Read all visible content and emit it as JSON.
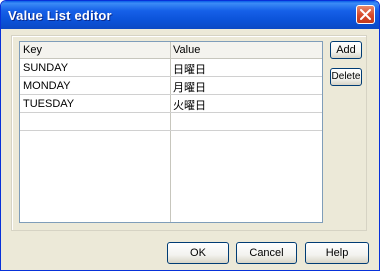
{
  "window": {
    "title": "Value List editor"
  },
  "table": {
    "headers": {
      "key": "Key",
      "value": "Value"
    },
    "rows": [
      {
        "key": "SUNDAY",
        "value": "日曜日"
      },
      {
        "key": "MONDAY",
        "value": "月曜日"
      },
      {
        "key": "TUESDAY",
        "value": "火曜日"
      },
      {
        "key": "",
        "value": ""
      }
    ]
  },
  "side_buttons": {
    "add": {
      "label": "Add"
    },
    "delete": {
      "label": "Delete"
    }
  },
  "footer_buttons": {
    "ok": {
      "label": "OK"
    },
    "cancel": {
      "label": "Cancel"
    },
    "help": {
      "label": "Help"
    }
  },
  "icons": {
    "close": "close-x-icon"
  },
  "colors": {
    "titlebar": "#0b52d8",
    "dialog_bg": "#ece9d8",
    "button_border": "#003c74",
    "close_button": "#d6482a"
  }
}
